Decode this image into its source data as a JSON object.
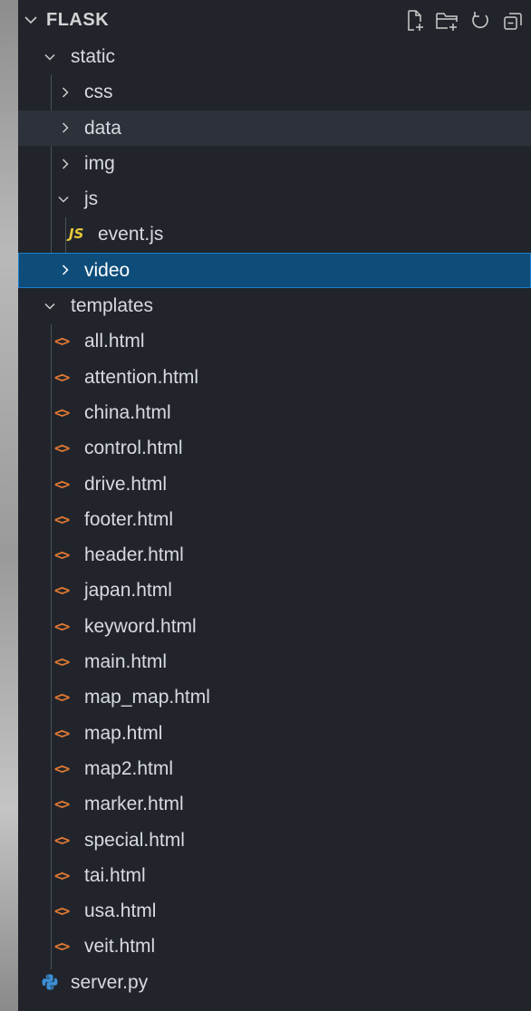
{
  "explorer": {
    "title": "FLASK",
    "actions": [
      {
        "name": "new-file-icon"
      },
      {
        "name": "new-folder-icon"
      },
      {
        "name": "refresh-icon"
      },
      {
        "name": "collapse-all-icon"
      }
    ],
    "colors": {
      "background": "#21252b",
      "selected": "#0e4d7a",
      "selected_border": "#1d7ecb",
      "html_icon": "#e37933",
      "js_icon": "#e6c93b",
      "python_icon": "#3b8fd6"
    }
  },
  "tree": {
    "static": {
      "label": "static"
    },
    "css": {
      "label": "css"
    },
    "data": {
      "label": "data"
    },
    "img": {
      "label": "img"
    },
    "js": {
      "label": "js"
    },
    "js_badge": "JS",
    "event_js": {
      "label": "event.js"
    },
    "video": {
      "label": "video"
    },
    "templates": {
      "label": "templates"
    },
    "html_files": [
      "all.html",
      "attention.html",
      "china.html",
      "control.html",
      "drive.html",
      "footer.html",
      "header.html",
      "japan.html",
      "keyword.html",
      "main.html",
      "map_map.html",
      "map.html",
      "map2.html",
      "marker.html",
      "special.html",
      "tai.html",
      "usa.html",
      "veit.html"
    ],
    "html_icon_glyph": "<>",
    "server_py": {
      "label": "server.py"
    }
  }
}
